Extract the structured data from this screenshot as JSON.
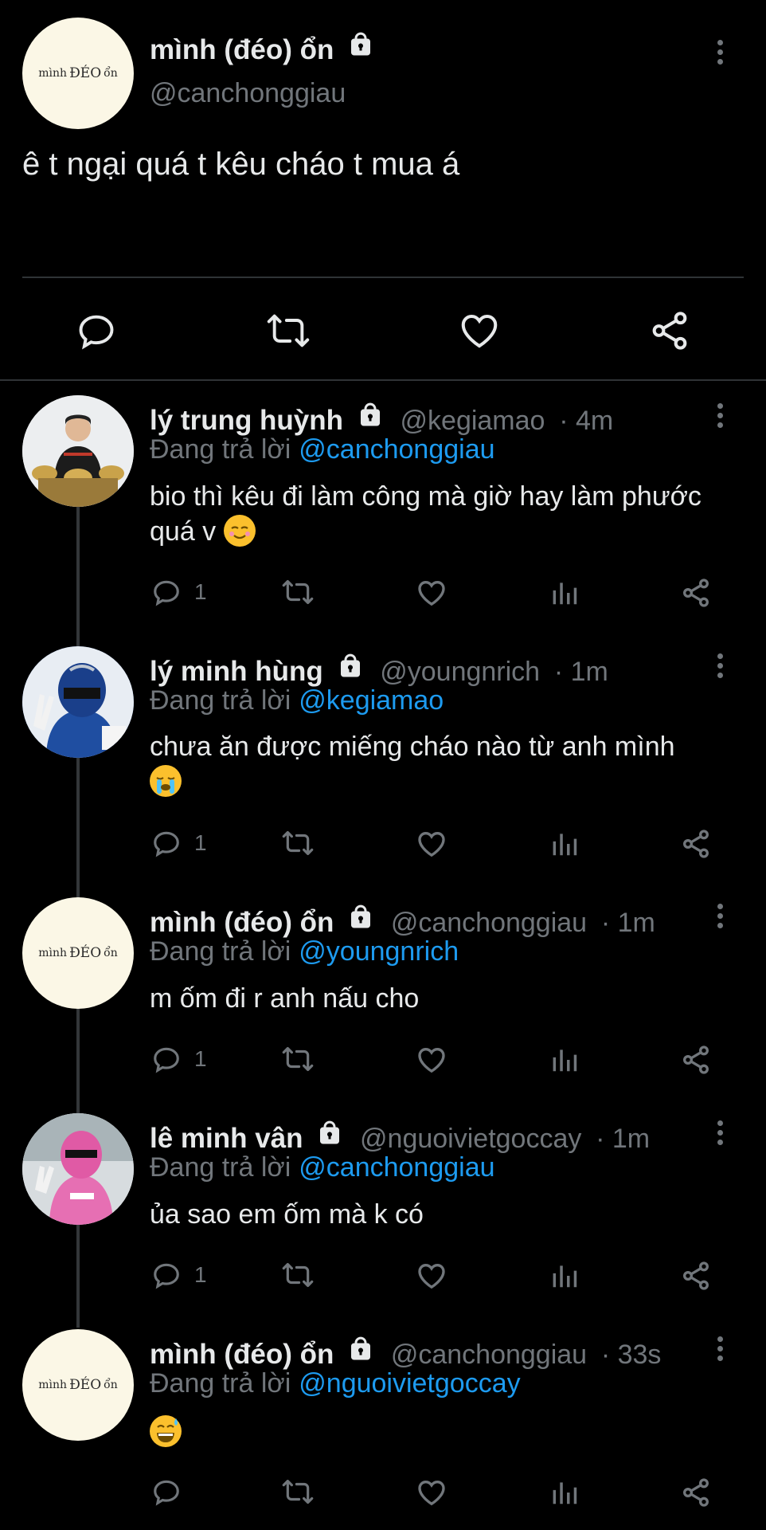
{
  "main_tweet": {
    "display_name": "mình (đéo) ổn",
    "handle": "@canchonggiau",
    "text": "ê t ngại quá t kêu cháo t mua á",
    "avatar_text": [
      "mình",
      "ĐÉO",
      "ổn"
    ]
  },
  "replies": [
    {
      "display_name": "lý trung huỳnh",
      "handle": "@kegiamao",
      "time": "· 4m",
      "replying_label": "Đang trả lời",
      "replying_to": "@canchonggiau",
      "text": "bio thì kêu đi làm công mà giờ hay làm phước quá v",
      "emoji": "relieved",
      "reply_count": "1"
    },
    {
      "display_name": "lý minh hùng",
      "handle": "@youngnrich",
      "time": "· 1m",
      "replying_label": "Đang trả lời",
      "replying_to": "@kegiamao",
      "text": "chưa ăn được miếng cháo nào từ anh mình",
      "emoji": "loudly-crying",
      "reply_count": "1"
    },
    {
      "display_name": "mình (đéo) ổn",
      "handle": "@canchonggiau",
      "time": "· 1m",
      "replying_label": "Đang trả lời",
      "replying_to": "@youngnrich",
      "text": "m ốm đi r anh nấu cho",
      "reply_count": "1",
      "avatar_text": [
        "mình",
        "ĐÉO",
        "ổn"
      ]
    },
    {
      "display_name": "lê minh vân",
      "handle": "@nguoivietgoccay",
      "time": "· 1m",
      "replying_label": "Đang trả lời",
      "replying_to": "@canchonggiau",
      "text": "ủa sao em ốm mà k có",
      "reply_count": "1"
    },
    {
      "display_name": "mình (đéo) ổn",
      "handle": "@canchonggiau",
      "time": "· 33s",
      "replying_label": "Đang trả lời",
      "replying_to": "@nguoivietgoccay",
      "text": "",
      "emoji": "grinning-sweat",
      "reply_count": "",
      "avatar_text": [
        "mình",
        "ĐÉO",
        "ổn"
      ]
    }
  ],
  "colors": {
    "background": "#000000",
    "text": "#e7e9ea",
    "secondary": "#71767b",
    "link": "#1d9bf0"
  }
}
